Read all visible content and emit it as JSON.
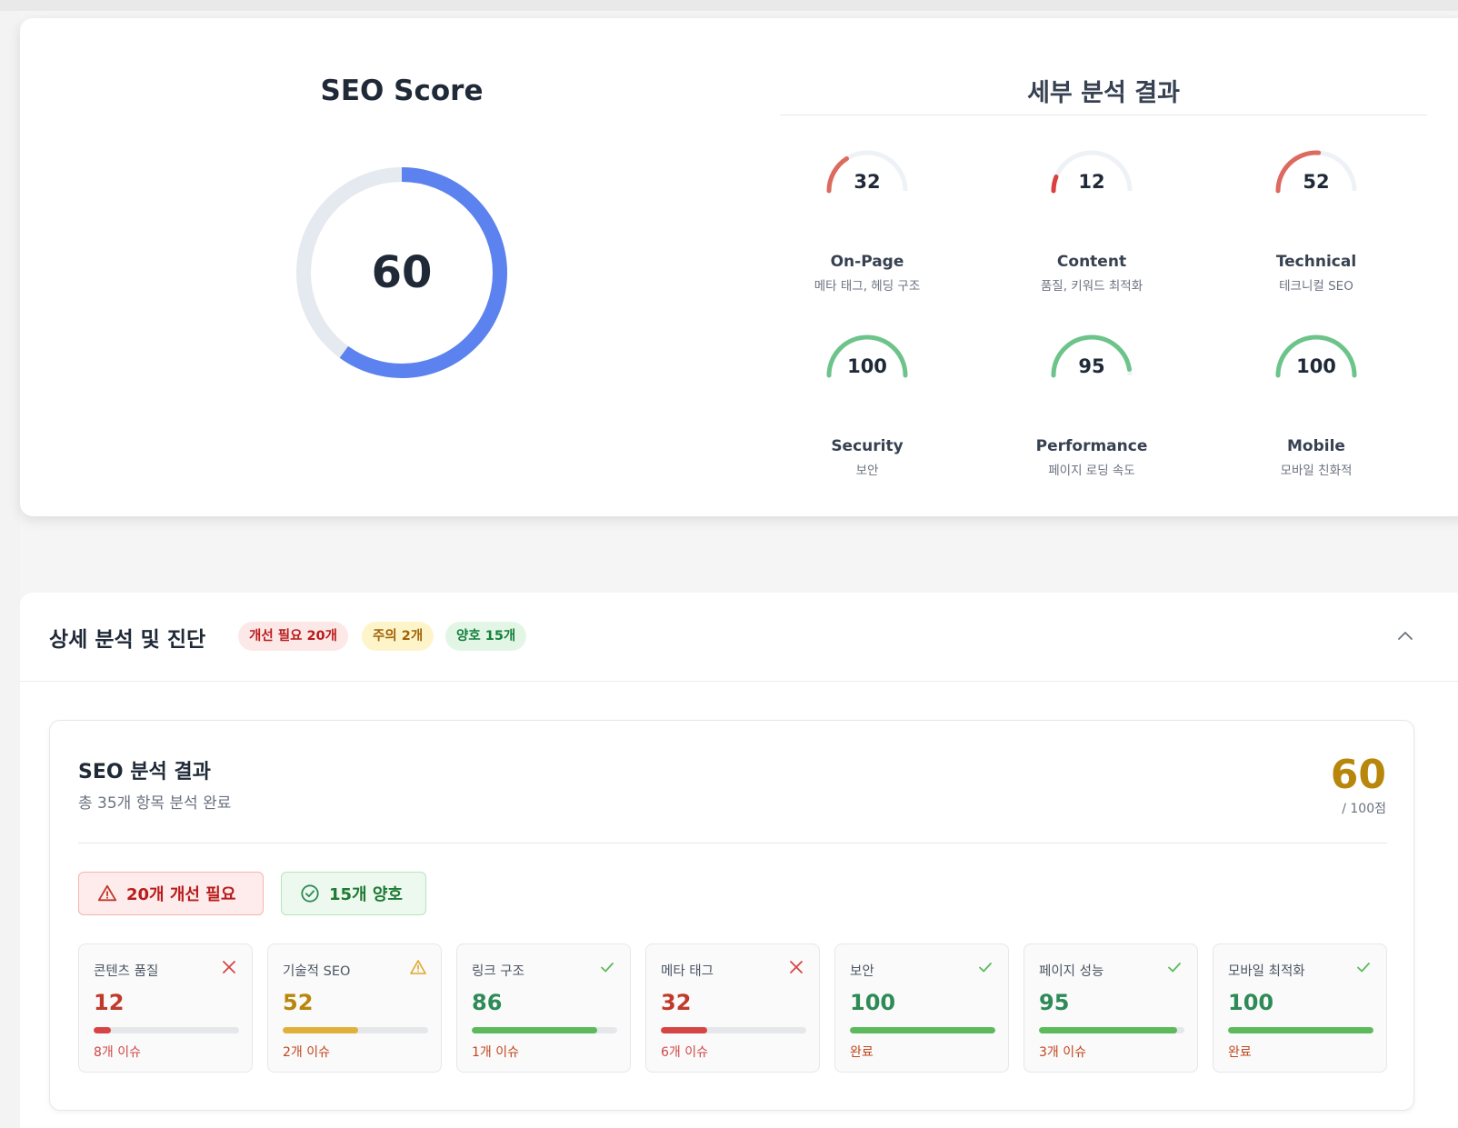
{
  "score_card": {
    "title": "SEO Score",
    "score": 60,
    "score_label": "60",
    "colors": {
      "ring": "#5b82ee",
      "track": "#e5e9f0"
    }
  },
  "detail_summary": {
    "title": "세부 분석 결과",
    "items": [
      {
        "value": 32,
        "value_label": "32",
        "name": "On-Page",
        "sub": "메타 태그, 헤딩 구조",
        "color": "#dc6a5f"
      },
      {
        "value": 12,
        "value_label": "12",
        "name": "Content",
        "sub": "품질, 키워드 최적화",
        "color": "#dc3f3f"
      },
      {
        "value": 52,
        "value_label": "52",
        "name": "Technical",
        "sub": "테크니컬 SEO",
        "color": "#dc6a5f"
      },
      {
        "value": 100,
        "value_label": "100",
        "name": "Security",
        "sub": "보안",
        "color": "#6cc48a"
      },
      {
        "value": 95,
        "value_label": "95",
        "name": "Performance",
        "sub": "페이지 로딩 속도",
        "color": "#6cc48a"
      },
      {
        "value": 100,
        "value_label": "100",
        "name": "Mobile",
        "sub": "모바일 친화적",
        "color": "#6cc48a"
      }
    ]
  },
  "panel": {
    "title": "상세 분석 및 진단",
    "chips": {
      "needs_improvement": "개선 필요 20개",
      "warning": "주의 2개",
      "good": "양호 15개"
    },
    "collapse_icon": "chevron-up-icon"
  },
  "result": {
    "title": "SEO 분석 결과",
    "subtitle": "총 35개 항목 분석 완료",
    "score": "60",
    "max": "/ 100점",
    "pill_red": "20개 개선 필요",
    "pill_green": "15개 양호",
    "metrics": [
      {
        "name": "콘텐츠 품질",
        "value": 12,
        "value_label": "12",
        "foot": "8개 이슈",
        "status": "fail",
        "color": "#c0392b",
        "bar": "#d64545"
      },
      {
        "name": "기술적 SEO",
        "value": 52,
        "value_label": "52",
        "foot": "2개 이슈",
        "status": "warn",
        "color": "#b8860b",
        "bar": "#e0b13a"
      },
      {
        "name": "링크 구조",
        "value": 86,
        "value_label": "86",
        "foot": "1개 이슈",
        "status": "pass",
        "color": "#2e8b57",
        "bar": "#5cba5c"
      },
      {
        "name": "메타 태그",
        "value": 32,
        "value_label": "32",
        "foot": "6개 이슈",
        "status": "fail",
        "color": "#c0392b",
        "bar": "#d64545"
      },
      {
        "name": "보안",
        "value": 100,
        "value_label": "100",
        "foot": "완료",
        "status": "pass",
        "color": "#2e8b57",
        "bar": "#5cba5c"
      },
      {
        "name": "페이지 성능",
        "value": 95,
        "value_label": "95",
        "foot": "3개 이슈",
        "status": "pass",
        "color": "#2e8b57",
        "bar": "#5cba5c"
      },
      {
        "name": "모바일 최적화",
        "value": 100,
        "value_label": "100",
        "foot": "완료",
        "status": "pass",
        "color": "#2e8b57",
        "bar": "#5cba5c"
      }
    ]
  }
}
